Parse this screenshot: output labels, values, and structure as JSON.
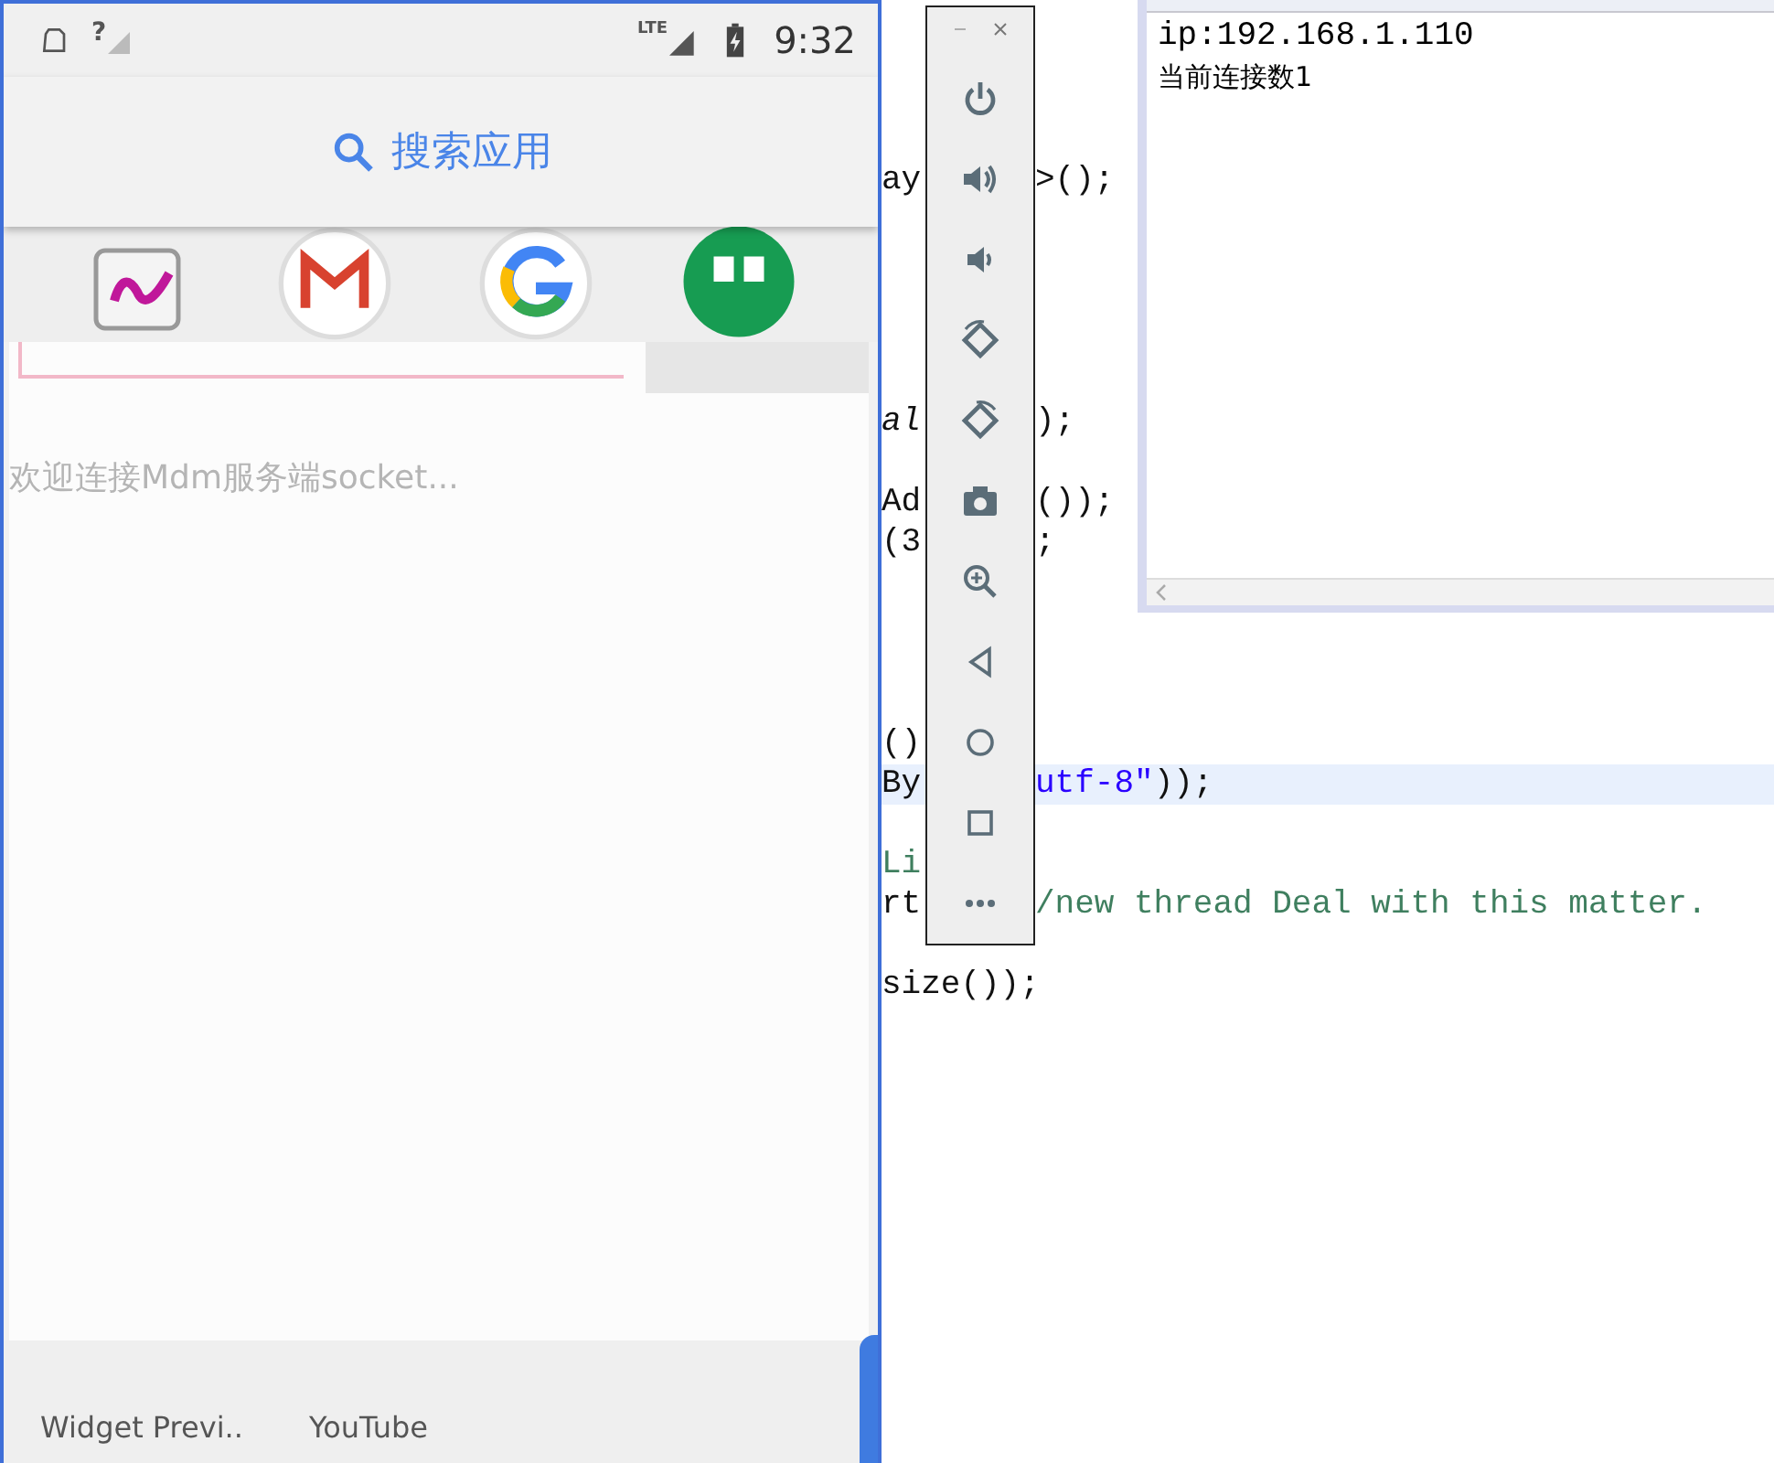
{
  "phone": {
    "status_bar": {
      "signal_badge": "?",
      "network_type": "LTE",
      "time": "9:32"
    },
    "search": {
      "label": "搜索应用"
    },
    "dialog": {
      "message": "欢迎连接Mdm服务端socket..."
    },
    "apps": [
      {
        "label": "Widget Previ.."
      },
      {
        "label": "YouTube"
      }
    ]
  },
  "console": {
    "lines": [
      "ip:192.168.1.110",
      "当前连接数1"
    ]
  },
  "editor": {
    "lines": [
      {
        "current": false
      },
      {
        "current": false
      },
      {
        "current": false
      },
      {
        "current": false
      },
      {
        "current": false,
        "left": [
          {
            "text": "ay",
            "kind": "code"
          }
        ],
        "right": [
          {
            "text": ">();",
            "kind": "code"
          }
        ]
      },
      {
        "current": false
      },
      {
        "current": false
      },
      {
        "current": false
      },
      {
        "current": false
      },
      {
        "current": false
      },
      {
        "current": false,
        "left": [
          {
            "text": "al",
            "kind": "field"
          }
        ],
        "right": [
          {
            "text": ");",
            "kind": "code"
          }
        ]
      },
      {
        "current": false
      },
      {
        "current": false,
        "left": [
          {
            "text": "Ad",
            "kind": "code"
          }
        ],
        "right": [
          {
            "text": "());",
            "kind": "code"
          }
        ]
      },
      {
        "current": false,
        "left": [
          {
            "text": "(3",
            "kind": "code"
          }
        ],
        "right": [
          {
            "text": ";",
            "kind": "code"
          }
        ]
      },
      {
        "current": false
      },
      {
        "current": false
      },
      {
        "current": false
      },
      {
        "current": false
      },
      {
        "current": false,
        "left": [
          {
            "text": "()",
            "kind": "code"
          }
        ]
      },
      {
        "current": true,
        "left": [
          {
            "text": "By",
            "kind": "code"
          }
        ],
        "right": [
          {
            "text": "utf-8\"",
            "kind": "string"
          },
          {
            "text": "));",
            "kind": "code"
          }
        ]
      },
      {
        "current": false
      },
      {
        "current": false,
        "left": [
          {
            "text": "Li",
            "kind": "comment"
          }
        ]
      },
      {
        "current": false,
        "left": [
          {
            "text": "rt",
            "kind": "code"
          }
        ],
        "right": [
          {
            "text": "/new thread Deal with this matter.",
            "kind": "comment"
          }
        ]
      },
      {
        "current": false
      },
      {
        "current": false,
        "left": [
          {
            "text": "size());",
            "kind": "code"
          }
        ]
      }
    ]
  }
}
